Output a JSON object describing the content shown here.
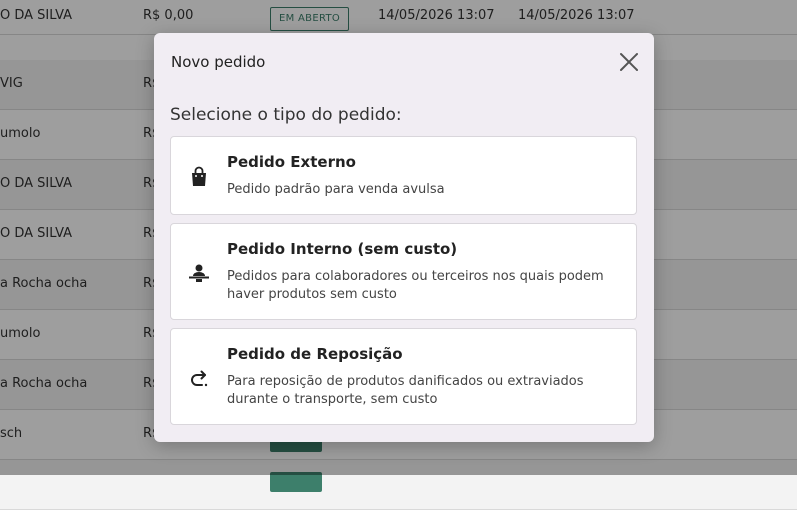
{
  "table": {
    "rows": [
      {
        "name": "O DA SILVA",
        "value": "R$ 0,00",
        "status": "EM ABERTO",
        "date1": "14/05/2026 13:07",
        "date2": "14/05/2026 13:07"
      },
      {
        "name": "VIG",
        "value": "R$",
        "status": "",
        "date1": "",
        "date2": ""
      },
      {
        "name": "umolo",
        "value": "R$",
        "status": "",
        "date1": "",
        "date2": ""
      },
      {
        "name": "O DA SILVA",
        "value": "R$",
        "status": "",
        "date1": "",
        "date2": ""
      },
      {
        "name": "O DA SILVA",
        "value": "R$",
        "status": "",
        "date1": "",
        "date2": ""
      },
      {
        "name": "a Rocha ocha",
        "value": "R$",
        "status": "",
        "date1": "",
        "date2": ""
      },
      {
        "name": "umolo",
        "value": "R$",
        "status": "",
        "date1": "",
        "date2": ""
      },
      {
        "name": "a Rocha ocha",
        "value": "R$",
        "status": "",
        "date1": "",
        "date2": ""
      },
      {
        "name": "sch",
        "value": "R$",
        "status": "",
        "date1": "",
        "date2": ""
      }
    ]
  },
  "modal": {
    "title": "Novo pedido",
    "subtitle": "Selecione o tipo do pedido:",
    "options": [
      {
        "icon": "shopping-bag-icon",
        "title": "Pedido Externo",
        "description": "Pedido padrão para venda avulsa"
      },
      {
        "icon": "person-desk-icon",
        "title": "Pedido Interno (sem custo)",
        "description": "Pedidos para colaboradores ou terceiros nos quais podem haver produtos sem custo"
      },
      {
        "icon": "redo-arrow-icon",
        "title": "Pedido de Reposição",
        "description": "Para reposição de produtos danificados ou extraviados durante o transporte, sem custo"
      }
    ]
  },
  "colors": {
    "accent": "#3d7f6b",
    "modal_bg": "#f1edf3"
  }
}
